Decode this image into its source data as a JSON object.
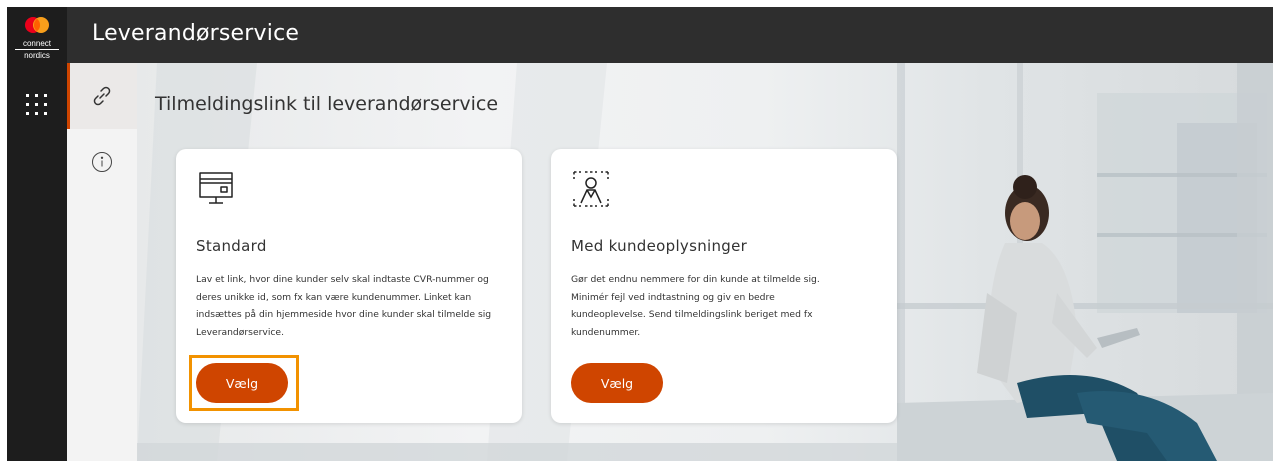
{
  "brand": {
    "line1": "connect",
    "line2": "nordics"
  },
  "header": {
    "title": "Leverandørservice"
  },
  "subnav": {
    "items": [
      {
        "icon": "link-icon"
      },
      {
        "icon": "info-icon"
      }
    ]
  },
  "main": {
    "title": "Tilmeldingslink til leverandørservice",
    "cards": [
      {
        "icon": "monitor-icon",
        "title": "Standard",
        "description": "Lav et link, hvor dine kunder selv skal indtaste CVR-nummer og deres unikke id, som fx kan være kundenummer. Linket kan indsættes på din hjemmeside hvor dine kunder skal tilmelde sig Leverandørservice.",
        "button": "Vælg"
      },
      {
        "icon": "person-scan-icon",
        "title": "Med kundeoplysninger",
        "description": "Gør det endnu nemmere for din kunde at tilmelde sig. Minimér fejl ved indtastning og giv en bedre kundeoplevelse. Send tilmeldingslink beriget med fx kundenummer.",
        "button": "Vælg"
      }
    ]
  },
  "colors": {
    "accent": "#cf4500",
    "highlight": "#f29200",
    "header": "#2e2e2e",
    "rail": "#1d1d1d"
  }
}
